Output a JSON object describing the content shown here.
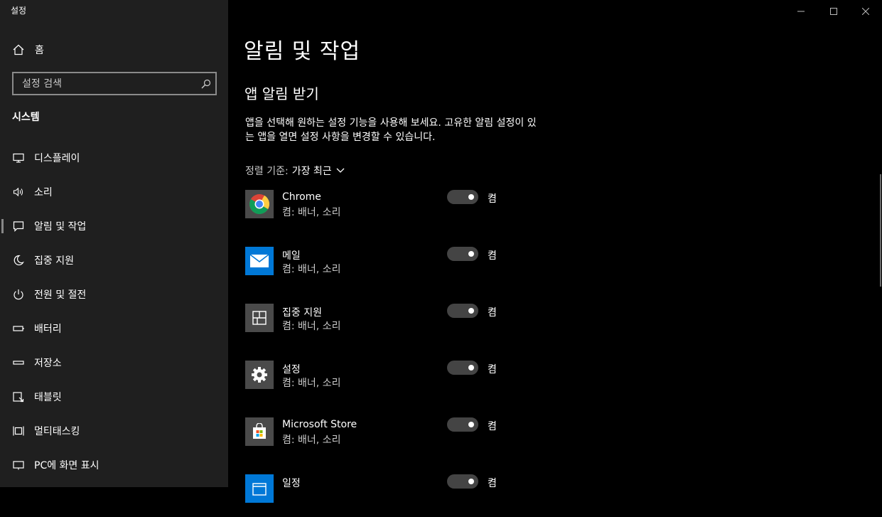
{
  "window": {
    "title": "설정"
  },
  "sidebar": {
    "home_label": "홈",
    "search_placeholder": "설정 검색",
    "section_label": "시스템",
    "items": [
      {
        "label": "디스플레이",
        "icon": "monitor-icon"
      },
      {
        "label": "소리",
        "icon": "speaker-icon"
      },
      {
        "label": "알림 및 작업",
        "icon": "notification-icon",
        "selected": true
      },
      {
        "label": "집중 지원",
        "icon": "moon-icon"
      },
      {
        "label": "전원 및 절전",
        "icon": "power-icon"
      },
      {
        "label": "배터리",
        "icon": "battery-icon"
      },
      {
        "label": "저장소",
        "icon": "storage-icon"
      },
      {
        "label": "태블릿",
        "icon": "tablet-icon"
      },
      {
        "label": "멀티태스킹",
        "icon": "multitasking-icon"
      },
      {
        "label": "PC에 화면 표시",
        "icon": "project-icon"
      }
    ]
  },
  "main": {
    "title": "알림 및 작업",
    "subtitle": "앱 알림 받기",
    "description_line1": "앱을 선택해 원하는 설정 기능을 사용해 보세요. 고유한 알림 설정이 있",
    "description_line2": "는 앱을 열면 설정 사항을 변경할 수 있습니다.",
    "sort": {
      "key": "정렬 기준:",
      "value": "가장 최근"
    },
    "apps": [
      {
        "name": "Chrome",
        "sub": "켬: 배너, 소리",
        "toggle": "켬",
        "on": true,
        "icon": "chrome-icon"
      },
      {
        "name": "메일",
        "sub": "켬: 배너, 소리",
        "toggle": "켬",
        "on": true,
        "icon": "mail-icon"
      },
      {
        "name": "집중 지원",
        "sub": "켬: 배너, 소리",
        "toggle": "켬",
        "on": true,
        "icon": "focus-assist-icon"
      },
      {
        "name": "설정",
        "sub": "켬: 배너, 소리",
        "toggle": "켬",
        "on": true,
        "icon": "settings-gear-icon"
      },
      {
        "name": "Microsoft Store",
        "sub": "켬: 배너, 소리",
        "toggle": "켬",
        "on": true,
        "icon": "store-icon"
      },
      {
        "name": "일정",
        "sub": "",
        "toggle": "켬",
        "on": true,
        "icon": "calendar-icon"
      }
    ]
  },
  "colors": {
    "sidebar_bg": "#1f1f1f",
    "main_bg": "#000000",
    "accent": "#0078d7",
    "toggle_track": "#444444"
  }
}
